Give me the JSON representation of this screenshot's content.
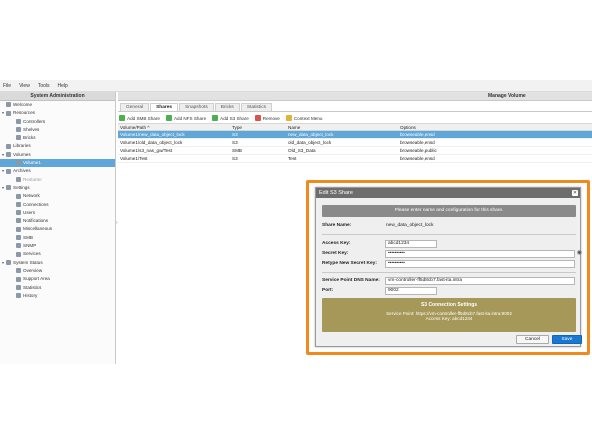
{
  "menubar": [
    "File",
    "View",
    "Tools",
    "Help"
  ],
  "left_header": "System Administration",
  "tree": [
    {
      "label": "Welcome",
      "indent": 0,
      "toggle": "",
      "icon": "home-icon"
    },
    {
      "label": "Resources",
      "indent": 0,
      "toggle": "▾",
      "icon": "grid-icon"
    },
    {
      "label": "Controllers",
      "indent": 1,
      "toggle": "",
      "icon": "server-icon"
    },
    {
      "label": "Shelves",
      "indent": 1,
      "toggle": "",
      "icon": "shelf-icon"
    },
    {
      "label": "Bricks",
      "indent": 1,
      "toggle": "",
      "icon": "brick-icon"
    },
    {
      "label": "Libraries",
      "indent": 0,
      "toggle": "",
      "icon": "library-icon"
    },
    {
      "label": "Volumes",
      "indent": 0,
      "toggle": "▾",
      "icon": "folder-icon"
    },
    {
      "label": "Volume1",
      "indent": 1,
      "toggle": "",
      "icon": "volume-icon",
      "selected": true
    },
    {
      "label": "Archives",
      "indent": 0,
      "toggle": "▾",
      "icon": "archive-icon"
    },
    {
      "label": "Restarter",
      "indent": 1,
      "toggle": "",
      "icon": "restart-icon",
      "disabled": true
    },
    {
      "label": "Settings",
      "indent": 0,
      "toggle": "▾",
      "icon": "gear-icon"
    },
    {
      "label": "Network",
      "indent": 1,
      "toggle": "",
      "icon": "network-icon"
    },
    {
      "label": "Connections",
      "indent": 1,
      "toggle": "",
      "icon": "connection-icon"
    },
    {
      "label": "Users",
      "indent": 1,
      "toggle": "",
      "icon": "users-icon"
    },
    {
      "label": "Notifications",
      "indent": 1,
      "toggle": "",
      "icon": "bell-icon"
    },
    {
      "label": "Miscellaneous",
      "indent": 1,
      "toggle": "",
      "icon": "misc-icon"
    },
    {
      "label": "SMB",
      "indent": 1,
      "toggle": "",
      "icon": "smb-icon"
    },
    {
      "label": "SNMP",
      "indent": 1,
      "toggle": "",
      "icon": "snmp-icon"
    },
    {
      "label": "Services",
      "indent": 1,
      "toggle": "",
      "icon": "services-icon"
    },
    {
      "label": "System Status",
      "indent": 0,
      "toggle": "▾",
      "icon": "info-icon"
    },
    {
      "label": "Overview",
      "indent": 1,
      "toggle": "",
      "icon": "eye-icon"
    },
    {
      "label": "Support Area",
      "indent": 1,
      "toggle": "",
      "icon": "support-icon"
    },
    {
      "label": "Statistics",
      "indent": 1,
      "toggle": "",
      "icon": "chart-icon"
    },
    {
      "label": "History",
      "indent": 1,
      "toggle": "",
      "icon": "history-icon"
    }
  ],
  "right_header": "Manage Volume",
  "tabs": [
    {
      "label": "General",
      "active": false
    },
    {
      "label": "Shares",
      "active": true
    },
    {
      "label": "Snapshots",
      "active": false
    },
    {
      "label": "Bricks",
      "active": false
    },
    {
      "label": "Statistics",
      "active": false
    }
  ],
  "toolbar": [
    {
      "label": "Add SMB Share",
      "color": "#4caf50",
      "icon": "add-icon"
    },
    {
      "label": "Add NFS Share",
      "color": "#4caf50",
      "icon": "add-icon"
    },
    {
      "label": "Add S3 Share",
      "color": "#4caf50",
      "icon": "add-icon"
    },
    {
      "label": "Remove",
      "color": "#d9534f",
      "icon": "remove-icon"
    },
    {
      "label": "Context Menu",
      "color": "#e0b43a",
      "icon": "menu-icon"
    }
  ],
  "grid": {
    "headers": [
      "Volume/Path ^",
      "Type",
      "Name",
      "Options"
    ],
    "rows": [
      {
        "cells": [
          "Volume1/new_data_object_lock",
          "S3",
          "new_data_object_lock",
          "browseable,ensd"
        ],
        "selected": true
      },
      {
        "cells": [
          "Volume1/old_data_object_lock",
          "S3",
          "old_data_object_lock",
          "browseable,ensd"
        ]
      },
      {
        "cells": [
          "Volume1/s3_nas_gw/Test",
          "SMB",
          "Old_S3_Data",
          "browseable,public"
        ]
      },
      {
        "cells": [
          "Volume1/Test",
          "S3",
          "Test",
          "browseable,ensd"
        ]
      }
    ]
  },
  "dialog": {
    "title": "Edit S3 Share",
    "info": "Please enter name and configuration for this share.",
    "share_name_label": "Share Name:",
    "share_name_value": "new_data_object_lock",
    "access_key_label": "Access Key:",
    "access_key_value": "abcd1234",
    "secret_key_label": "Secret Key:",
    "secret_key_value": "••••••••••",
    "retype_label": "Retype New Secret Key:",
    "retype_value": "••••••••••",
    "dns_label": "Service Point DNS Name:",
    "dns_value": "vm-controller-ff5d8cb7.fast-ita.intra",
    "port_label": "Port:",
    "port_value": "9002",
    "conn_title": "S3 Connection Settings",
    "conn_service_point": "Service Point: https://vm-controller-ff5d8cb7.fast-ita.intra:9002",
    "conn_access_key": "Access Key: abcd1234",
    "cancel_label": "Cancel",
    "save_label": "Save"
  },
  "colors": {
    "highlight": "#f08a1d",
    "selection": "#5fa7d8",
    "save": "#1979d2",
    "conn_panel": "#a59858"
  }
}
